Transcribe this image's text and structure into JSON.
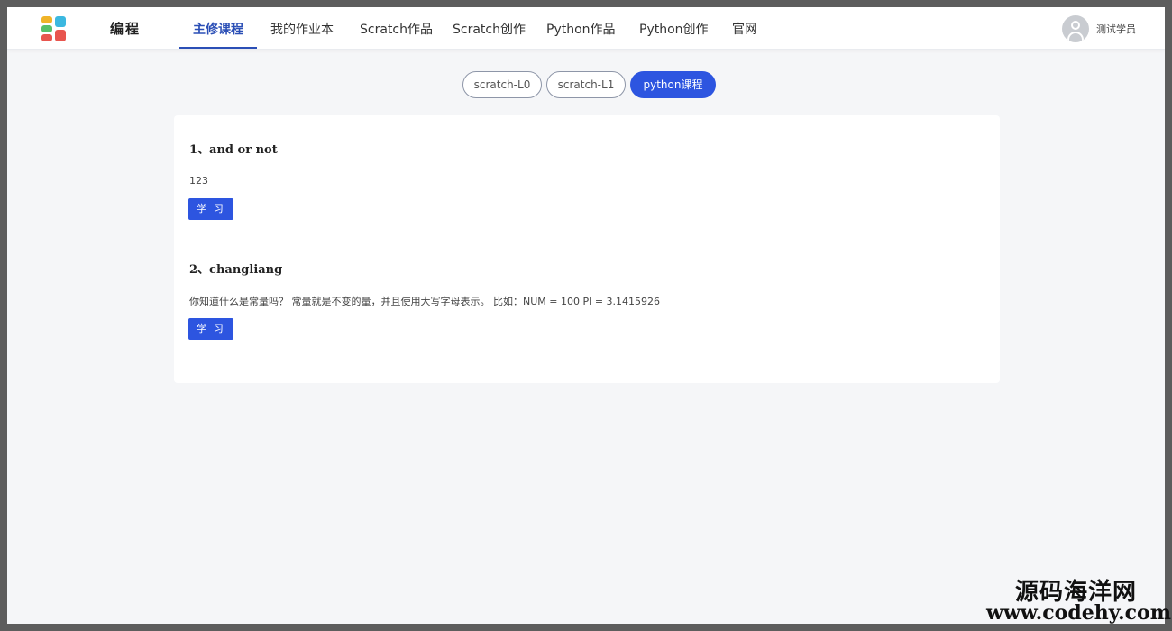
{
  "header": {
    "brand": "编程",
    "nav": [
      {
        "label": "主修课程",
        "active": true
      },
      {
        "label": "我的作业本",
        "active": false
      },
      {
        "label": "Scratch作品",
        "active": false
      },
      {
        "label": "Scratch创作",
        "active": false
      },
      {
        "label": "Python作品",
        "active": false
      },
      {
        "label": "Python创作",
        "active": false
      },
      {
        "label": "官网",
        "active": false
      }
    ],
    "username": "测试学员"
  },
  "course_tabs": [
    {
      "label": "scratch-L0",
      "active": false
    },
    {
      "label": "scratch-L1",
      "active": false
    },
    {
      "label": "python课程",
      "active": true
    }
  ],
  "lessons": [
    {
      "title": "1、and or not",
      "description": "123",
      "button": "学 习"
    },
    {
      "title": "2、changliang",
      "description": "你知道什么是常量吗？ 常量就是不变的量，并且使用大写字母表示。 比如：NUM = 100 PI = 3.1415926",
      "button": "学 习"
    }
  ],
  "watermark": {
    "line1": "源码海洋网",
    "line2": "www.codehy.com"
  },
  "colors": {
    "accent": "#2d55e0",
    "nav_active": "#2b4fb6",
    "background": "#f5f6f8",
    "outer_frame": "#5d5d5d"
  }
}
